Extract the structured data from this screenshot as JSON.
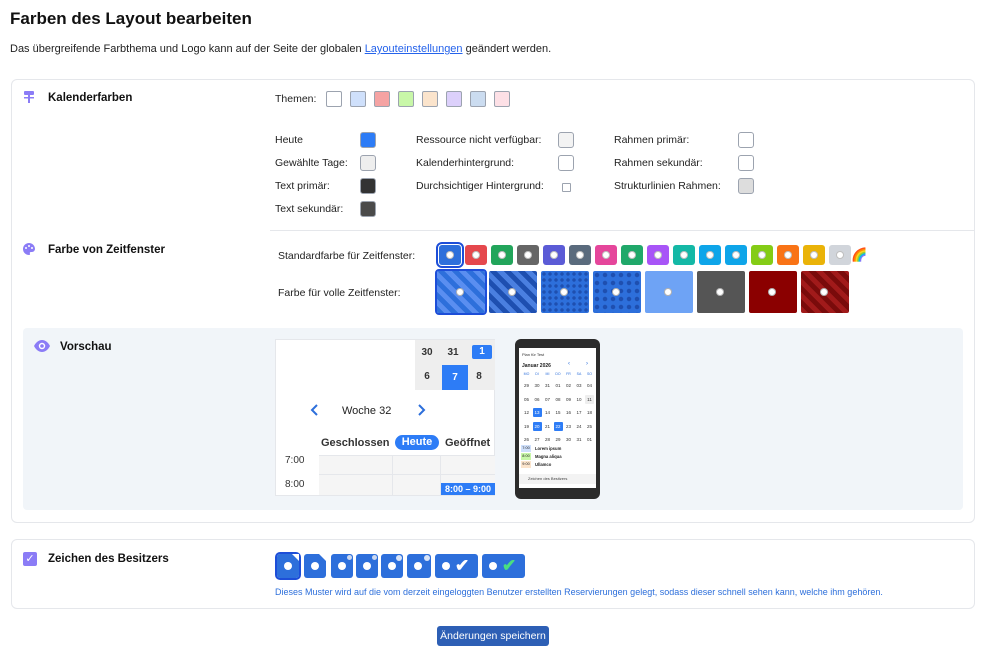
{
  "page": {
    "title": "Farben des Layout bearbeiten",
    "intro_before": "Das übergreifende Farbthema und Logo kann auf der Seite der globalen ",
    "intro_link": "Layouteinstellungen",
    "intro_after": " geändert werden."
  },
  "calendar_colors": {
    "title": "Kalenderfarben",
    "themes_label": "Themen:",
    "theme_swatches": [
      "#ffffff",
      "#cfe0fb",
      "#f5a3a3",
      "#c8f7a8",
      "#fbe4cc",
      "#dcd0fb",
      "#cbdcf0",
      "#fde0e6"
    ],
    "col1": [
      {
        "label": "Heute",
        "color": "#2d7cf6"
      },
      {
        "label": "Gewählte Tage:",
        "color": "#eeeeee"
      },
      {
        "label": "Text primär:",
        "color": "#333333"
      },
      {
        "label": "Text sekundär:",
        "color": "#4a4a4a"
      }
    ],
    "col2": [
      {
        "label": "Ressource nicht verfügbar:",
        "color": "#f3f3f3"
      },
      {
        "label": "Kalenderhintergrund:",
        "color": "#ffffff"
      },
      {
        "label": "Durchsichtiger Hintergrund:",
        "color": "#ffffff"
      }
    ],
    "col3": [
      {
        "label": "Rahmen primär:",
        "color": "#ffffff"
      },
      {
        "label": "Rahmen sekundär:",
        "color": "#ffffff"
      },
      {
        "label": "Strukturlinien Rahmen:",
        "color": "#dddddd"
      }
    ]
  },
  "timeslot_colors": {
    "title": "Farbe von Zeitfenster",
    "standard_label": "Standardfarbe für Zeitfenster:",
    "full_label": "Farbe für volle Zeitfenster:",
    "standard_colors": [
      "#2d6fdb",
      "#e5484d",
      "#22a55b",
      "#666666",
      "#5b5bd6",
      "#5a6b7d",
      "#e5469b",
      "#20a86a",
      "#a855f7",
      "#14b8a6",
      "#0ea5e9",
      "#0ea5e9",
      "#84cc16",
      "#f97316",
      "#eab308",
      "#d1d5db"
    ],
    "rainbow_icon": "rainbow-icon",
    "full_colors": [
      "#2d6fdb",
      "#1e4fb0",
      "#2d6fdb",
      "#2d6fdb",
      "#6ea3f5",
      "#555555",
      "#8b0000",
      "#a11a1a"
    ]
  },
  "preview": {
    "title": "Vorschau",
    "mini_days_top": [
      "30",
      "31",
      "1"
    ],
    "mini_days_bottom": [
      "6",
      "7",
      "8"
    ],
    "week_label": "Woche 32",
    "col_closed": "Geschlossen",
    "col_today": "Heute",
    "col_open": "Geöffnet",
    "time_1": "7:00",
    "time_2": "8:00",
    "slot_label": "8:00 – 9:00",
    "phone": {
      "header": "Plan für Test",
      "month": "Januar 2026",
      "weekdays": [
        "MO",
        "DI",
        "MI",
        "DO",
        "FR",
        "SA",
        "SO"
      ],
      "weeks": [
        [
          "29",
          "30",
          "31",
          "01",
          "02",
          "03",
          "04"
        ],
        [
          "05",
          "06",
          "07",
          "08",
          "09",
          "10",
          "11"
        ],
        [
          "12",
          "13",
          "14",
          "15",
          "16",
          "17",
          "18"
        ],
        [
          "19",
          "20",
          "21",
          "22",
          "23",
          "24",
          "25"
        ],
        [
          "26",
          "27",
          "28",
          "29",
          "30",
          "31",
          "01"
        ]
      ],
      "events": [
        {
          "time": "7:00",
          "title": "Lorem ipsum",
          "color": "#cfe0fb"
        },
        {
          "time": "8:00",
          "title": "Magna aliqua",
          "color": "#c8f7a8"
        },
        {
          "time": "9:00",
          "title": "Ullamco",
          "color": "#fbe4cc"
        }
      ],
      "footer": "Zeichen des Besitzers"
    }
  },
  "owner_mark": {
    "title": "Zeichen des Besitzers",
    "description": "Dieses Muster wird auf die vom derzeit eingeloggten Benutzer erstellten Reservierungen gelegt, sodass dieser schnell sehen kann, welche ihm gehören."
  },
  "actions": {
    "save_label": "Änderungen speichern"
  },
  "colors": {
    "accent": "#2d6fdb",
    "link": "#2563eb",
    "section_icon": "#8b7cf6"
  }
}
